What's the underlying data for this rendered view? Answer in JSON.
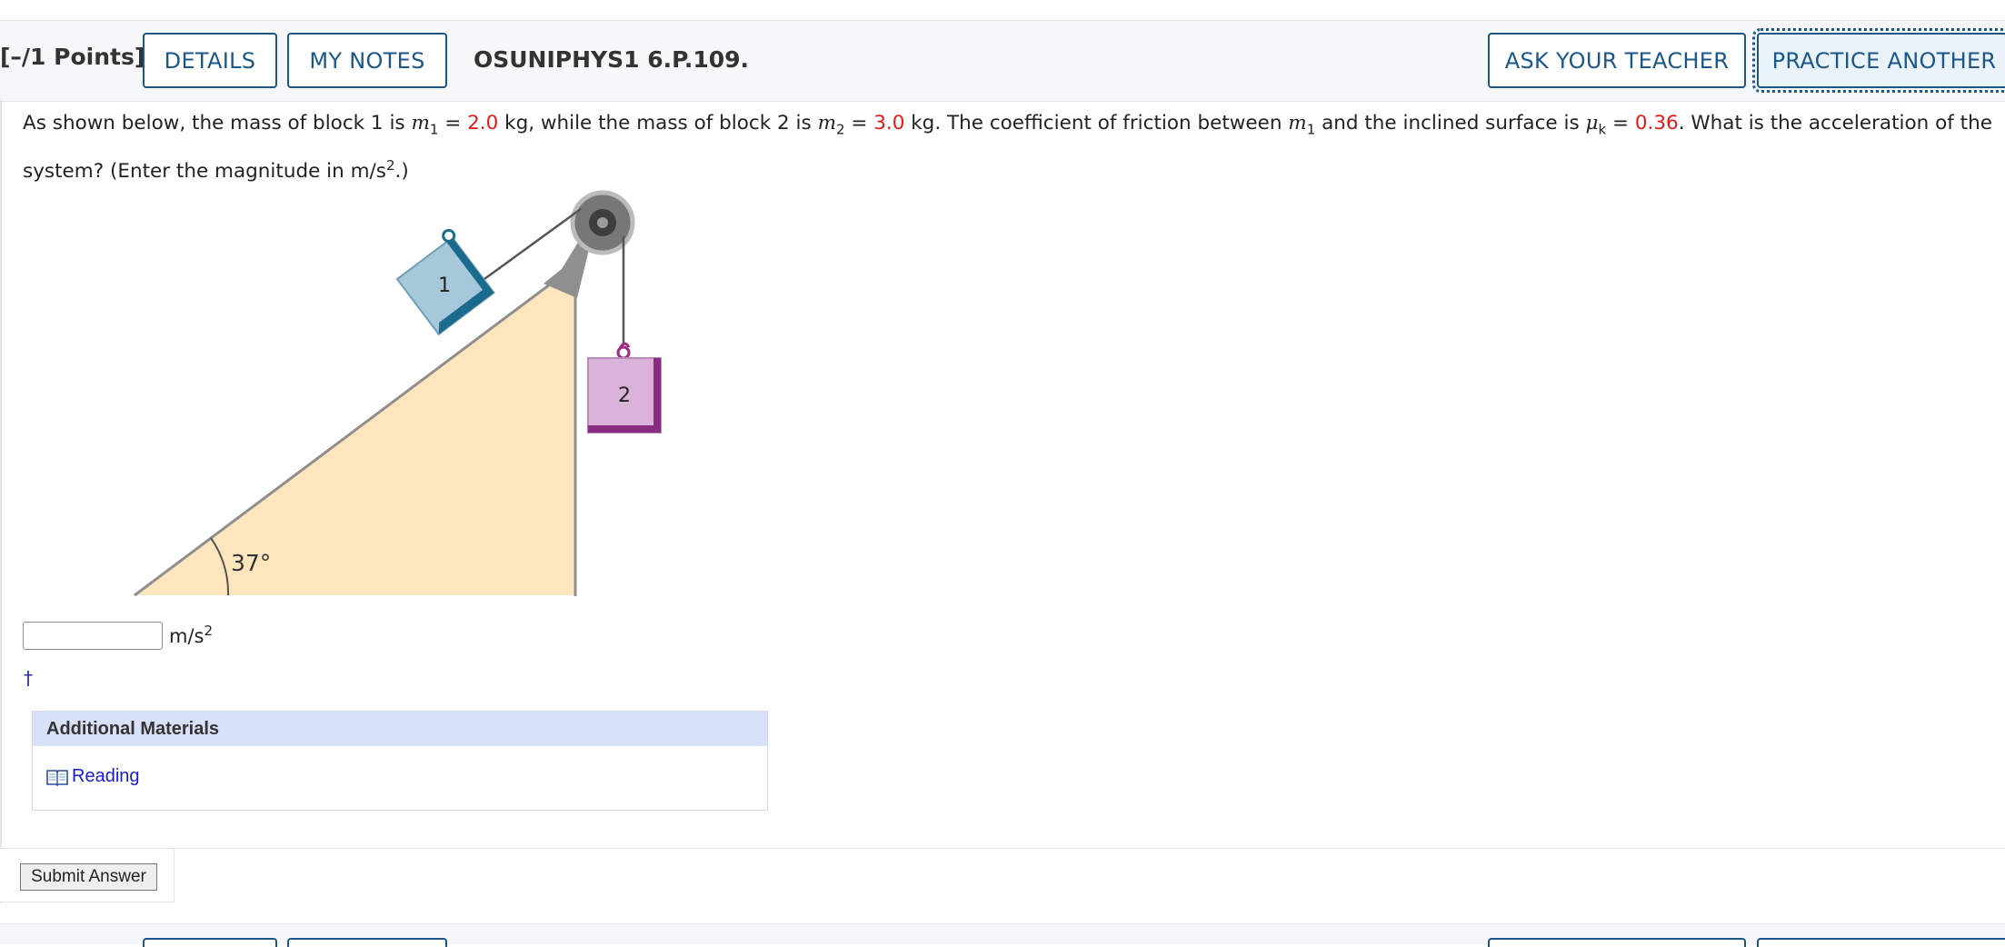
{
  "header": {
    "points": "[–/1 Points]",
    "details_label": "DETAILS",
    "notes_label": "MY NOTES",
    "question_id": "OSUNIPHYS1 6.P.109.",
    "ask_teacher_label": "ASK YOUR TEACHER",
    "practice_label": "PRACTICE ANOTHER"
  },
  "question": {
    "t1": "As shown below, the mass of block 1 is ",
    "m": "m",
    "sub1": "1",
    "eq": " = ",
    "m1_value": "2.0",
    "t2": " kg, while the mass of block 2 is ",
    "sub2": "2",
    "m2_value": "3.0",
    "t3": " kg. The coefficient of friction between ",
    "t4": " and the inclined surface is ",
    "mu": "μ",
    "subk": "k",
    "mu_value": "0.36",
    "t5": ". What is the acceleration of the system? (Enter the magnitude in m/s",
    "sup2": "2",
    "t6": ".)"
  },
  "figure": {
    "block1_label": "1",
    "block2_label": "2",
    "angle_label": "37°"
  },
  "answer": {
    "value": "",
    "unit_base": "m/s",
    "unit_exp": "2",
    "dagger": "†"
  },
  "additional": {
    "header": "Additional Materials",
    "reading_label": "Reading"
  },
  "submit_label": "Submit Answer",
  "colors": {
    "accent": "#1b5789",
    "given_value": "#e01b1b",
    "link": "#1a1acc",
    "incline_fill": "#fde5be",
    "block1_fill": "#a6c8da",
    "block2_fill": "#d9b3d9"
  }
}
